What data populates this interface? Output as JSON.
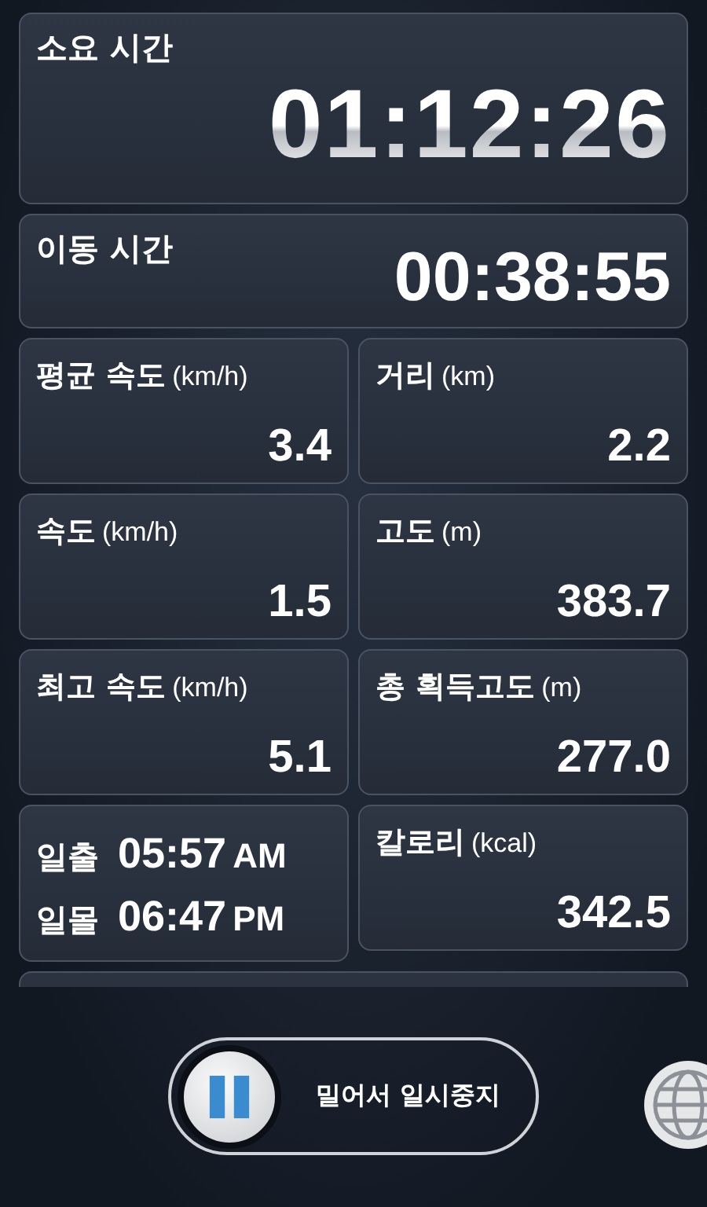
{
  "timers": [
    {
      "label": "소요 시간",
      "value": "01:12:26",
      "kind": "large"
    },
    {
      "label": "이동 시간",
      "value": "00:38:55",
      "kind": "medium"
    }
  ],
  "tiles": [
    {
      "kind": "stat",
      "label": "평균 속도",
      "unit": "(km/h)",
      "value": "3.4"
    },
    {
      "kind": "stat",
      "label": "거리",
      "unit": "(km)",
      "value": "2.2"
    },
    {
      "kind": "stat",
      "label": "속도",
      "unit": "(km/h)",
      "value": "1.5"
    },
    {
      "kind": "stat",
      "label": "고도",
      "unit": "(m)",
      "value": "383.7"
    },
    {
      "kind": "stat",
      "label": "최고 속도",
      "unit": "(km/h)",
      "value": "5.1"
    },
    {
      "kind": "stat",
      "label": "총 획득고도",
      "unit": "(m)",
      "value": "277.0"
    },
    {
      "kind": "sun",
      "rows": [
        {
          "label": "일출",
          "time": "05:57",
          "period": "AM"
        },
        {
          "label": "일몰",
          "time": "06:47",
          "period": "PM"
        }
      ]
    },
    {
      "kind": "stat",
      "label": "칼로리",
      "unit": "(kcal)",
      "value": "342.5"
    }
  ],
  "pause_slider": {
    "label": "밀어서 일시중지",
    "level": 0
  }
}
